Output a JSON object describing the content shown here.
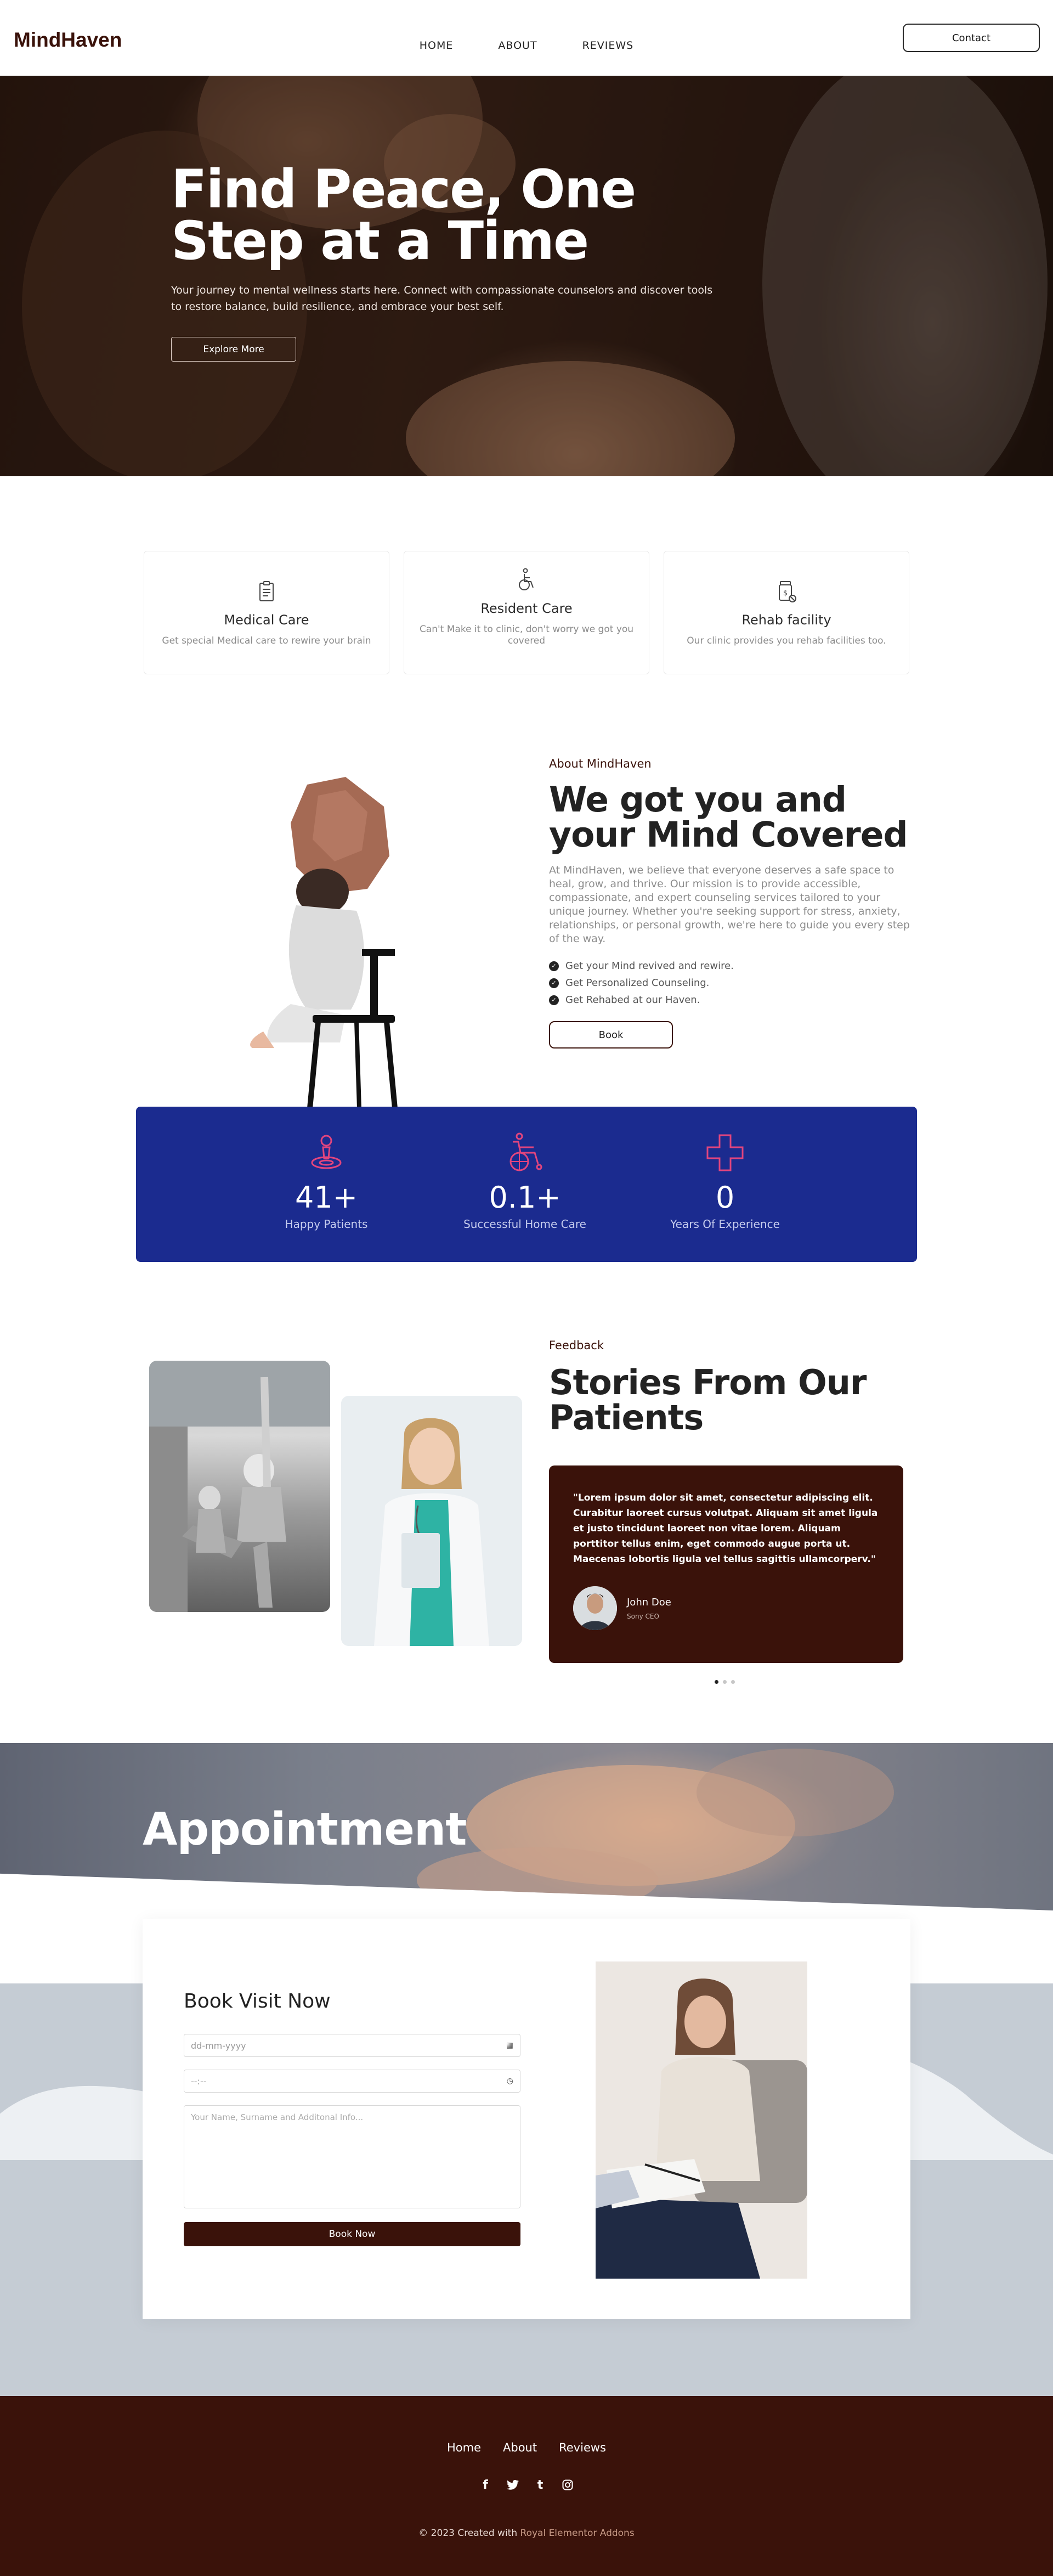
{
  "header": {
    "logo": "MindHaven",
    "nav": [
      "HOME",
      "ABOUT",
      "REVIEWS"
    ],
    "contact_label": "Contact"
  },
  "hero": {
    "title": "Find Peace, One Step at a Time",
    "subtitle": "Your journey to mental wellness starts here. Connect with compassionate counselors and discover tools to restore balance, build resilience, and embrace your best self.",
    "cta_label": "Explore More"
  },
  "services": [
    {
      "icon": "clipboard-icon",
      "title": "Medical Care",
      "desc": "Get special Medical care to rewire your brain"
    },
    {
      "icon": "wheelchair-icon",
      "title": "Resident Care",
      "desc": "Can't Make it to clinic, don't worry we got you covered"
    },
    {
      "icon": "pill-bottle-icon",
      "title": "Rehab facility",
      "desc": "Our clinic provides you rehab facilities too."
    }
  ],
  "about": {
    "kicker": "About MindHaven",
    "title": "We got you and your Mind Covered",
    "description": "At MindHaven, we believe that everyone deserves a safe space to heal, grow, and thrive. Our mission is to provide accessible, compassionate, and expert counseling services tailored to your unique journey. Whether you're seeking support for stress, anxiety, relationships, or personal growth, we're here to guide you every step of the way.",
    "checklist": [
      "Get your Mind revived and rewire.",
      "Get Personalized Counseling.",
      "Get Rehabed at our Haven."
    ],
    "book_label": "Book"
  },
  "stats": [
    {
      "icon": "location-pin-icon",
      "value": "41+",
      "label": "Happy Patients"
    },
    {
      "icon": "wheelchair-icon",
      "value": "0.1+",
      "label": "Successful Home Care"
    },
    {
      "icon": "medical-cross-icon",
      "value": "0",
      "label": "Years Of Experience"
    }
  ],
  "testimonials": {
    "kicker": "Feedback",
    "title": "Stories From Our Patients",
    "quote": "\"Lorem ipsum dolor sit amet, consectetur adipiscing elit. Curabitur laoreet cursus volutpat. Aliquam sit amet ligula et justo tincidunt laoreet non vitae lorem. Aliquam porttitor tellus enim, eget commodo augue porta ut. Maecenas lobortis ligula vel tellus sagittis ullamcorperv.\"",
    "name": "John Doe",
    "role": "Sony CEO"
  },
  "appointment": {
    "banner_title": "Appointment",
    "form_title": "Book Visit Now",
    "date_placeholder": "dd-mm-yyyy",
    "time_placeholder": "--:--",
    "message_placeholder": "Your Name, Surname and Additonal Info...",
    "submit_label": "Book Now"
  },
  "footer": {
    "nav": [
      "Home",
      "About",
      "Reviews"
    ],
    "copyright_prefix": "© 2023 Created with",
    "copyright_link": "Royal Elementor Addons"
  },
  "colors": {
    "brand": "#3a120a",
    "stats_bg": "#1b2b8f",
    "stats_icon": "#e2457e"
  }
}
